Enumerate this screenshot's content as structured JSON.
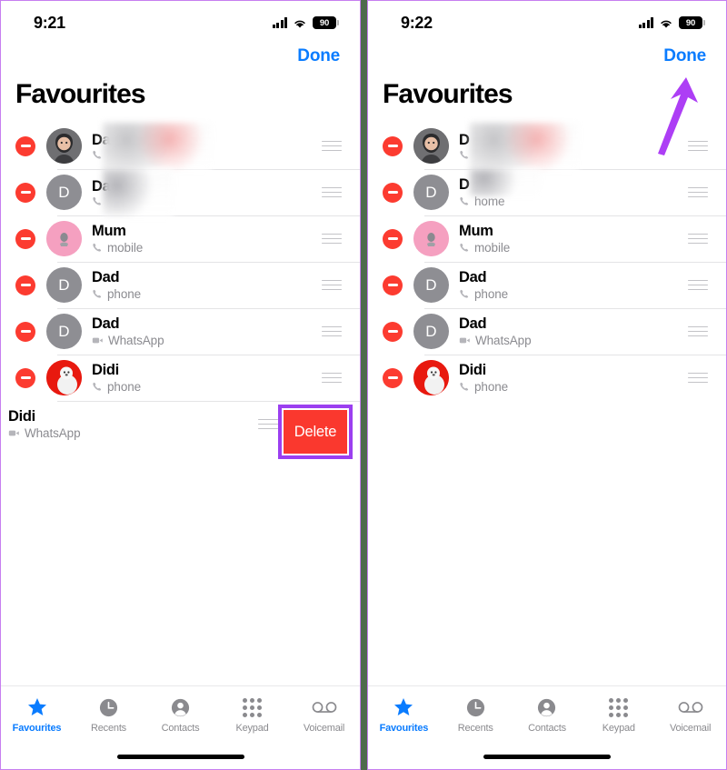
{
  "theme": {
    "accent_blue": "#0a7cff",
    "delete_red": "#fa382e",
    "minus_red": "#fc3b30",
    "annotation_purple": "#9b3ff0",
    "divider_green": "#4e6b4c",
    "panel_border": "#c77ef0"
  },
  "panels": [
    {
      "id": "left",
      "status": {
        "time": "9:21",
        "battery": "90",
        "signal_icon": "cellular-bars-icon",
        "wifi_icon": "wifi-icon",
        "battery_icon": "battery-icon"
      },
      "nav": {
        "done_label": "Done"
      },
      "title": "Favourites",
      "rows": [
        {
          "name": "Da",
          "redacted": true,
          "redaction": "wide",
          "sub": "",
          "sub_icon": "phone-icon",
          "avatar": "photo",
          "avatar_letter": "",
          "grab_icon": "reorder-handle-icon",
          "remove_icon": "remove-minus-icon"
        },
        {
          "name": "Da",
          "redacted": true,
          "redaction": "narrow",
          "sub": "",
          "sub_icon": "phone-icon",
          "avatar": "initial",
          "avatar_letter": "D",
          "grab_icon": "reorder-handle-icon",
          "remove_icon": "remove-minus-icon"
        },
        {
          "name": "Mum",
          "redacted": false,
          "sub": "mobile",
          "sub_icon": "phone-icon",
          "avatar": "pink",
          "avatar_letter": "",
          "grab_icon": "reorder-handle-icon",
          "remove_icon": "remove-minus-icon"
        },
        {
          "name": "Dad",
          "redacted": false,
          "sub": "phone",
          "sub_icon": "phone-icon",
          "avatar": "initial",
          "avatar_letter": "D",
          "grab_icon": "reorder-handle-icon",
          "remove_icon": "remove-minus-icon"
        },
        {
          "name": "Dad",
          "redacted": false,
          "sub": "WhatsApp",
          "sub_icon": "video-camera-icon",
          "avatar": "initial",
          "avatar_letter": "D",
          "grab_icon": "reorder-handle-icon",
          "remove_icon": "remove-minus-icon"
        },
        {
          "name": "Didi",
          "redacted": false,
          "sub": "phone",
          "sub_icon": "phone-icon",
          "avatar": "red",
          "avatar_letter": "",
          "grab_icon": "reorder-handle-icon",
          "remove_icon": "remove-minus-icon"
        },
        {
          "name": "Didi",
          "redacted": false,
          "sub": "WhatsApp",
          "sub_icon": "video-camera-icon",
          "avatar": "red",
          "avatar_letter": "",
          "swiped": true,
          "delete_label": "Delete",
          "grab_icon": "reorder-handle-icon",
          "remove_icon": "remove-minus-icon"
        }
      ],
      "has_delete_highlight": true,
      "has_arrow": false,
      "tabs": [
        {
          "label": "Favourites",
          "icon": "star-icon",
          "active": true
        },
        {
          "label": "Recents",
          "icon": "clock-icon",
          "active": false
        },
        {
          "label": "Contacts",
          "icon": "person-circle-icon",
          "active": false
        },
        {
          "label": "Keypad",
          "icon": "keypad-grid-icon",
          "active": false
        },
        {
          "label": "Voicemail",
          "icon": "voicemail-icon",
          "active": false
        }
      ]
    },
    {
      "id": "right",
      "status": {
        "time": "9:22",
        "battery": "90",
        "signal_icon": "cellular-bars-icon",
        "wifi_icon": "wifi-icon",
        "battery_icon": "battery-icon"
      },
      "nav": {
        "done_label": "Done"
      },
      "title": "Favourites",
      "rows": [
        {
          "name": "D",
          "redacted": true,
          "redaction": "wide",
          "sub": "",
          "sub_icon": "phone-icon",
          "avatar": "photo",
          "avatar_letter": "",
          "grab_icon": "reorder-handle-icon",
          "remove_icon": "remove-minus-icon"
        },
        {
          "name": "D",
          "redacted": true,
          "redaction": "narrow",
          "sub": "home",
          "sub_icon": "phone-icon",
          "avatar": "initial",
          "avatar_letter": "D",
          "grab_icon": "reorder-handle-icon",
          "remove_icon": "remove-minus-icon"
        },
        {
          "name": "Mum",
          "redacted": false,
          "sub": "mobile",
          "sub_icon": "phone-icon",
          "avatar": "pink",
          "avatar_letter": "",
          "grab_icon": "reorder-handle-icon",
          "remove_icon": "remove-minus-icon"
        },
        {
          "name": "Dad",
          "redacted": false,
          "sub": "phone",
          "sub_icon": "phone-icon",
          "avatar": "initial",
          "avatar_letter": "D",
          "grab_icon": "reorder-handle-icon",
          "remove_icon": "remove-minus-icon"
        },
        {
          "name": "Dad",
          "redacted": false,
          "sub": "WhatsApp",
          "sub_icon": "video-camera-icon",
          "avatar": "initial",
          "avatar_letter": "D",
          "grab_icon": "reorder-handle-icon",
          "remove_icon": "remove-minus-icon"
        },
        {
          "name": "Didi",
          "redacted": false,
          "sub": "phone",
          "sub_icon": "phone-icon",
          "avatar": "red",
          "avatar_letter": "",
          "grab_icon": "reorder-handle-icon",
          "remove_icon": "remove-minus-icon"
        }
      ],
      "has_delete_highlight": false,
      "has_arrow": true,
      "arrow_target": "Done",
      "tabs": [
        {
          "label": "Favourites",
          "icon": "star-icon",
          "active": true
        },
        {
          "label": "Recents",
          "icon": "clock-icon",
          "active": false
        },
        {
          "label": "Contacts",
          "icon": "person-circle-icon",
          "active": false
        },
        {
          "label": "Keypad",
          "icon": "keypad-grid-icon",
          "active": false
        },
        {
          "label": "Voicemail",
          "icon": "voicemail-icon",
          "active": false
        }
      ]
    }
  ]
}
